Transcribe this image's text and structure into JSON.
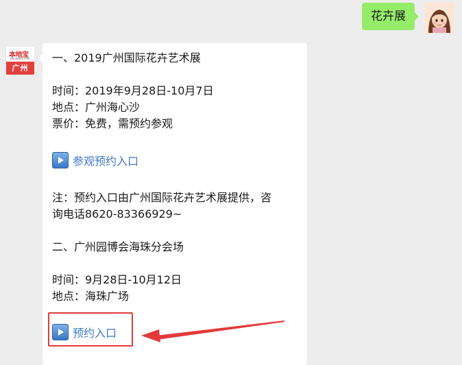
{
  "chat": {
    "outgoing_message": "花卉展",
    "incoming": {
      "avatar_logo_text": "本地宝",
      "avatar_logo_small": "Bendibao.com",
      "avatar_city": "广州",
      "heading1": "一、2019广州国际花卉艺术展",
      "time1": "时间：2019年9月28日-10月7日",
      "place1": "地点：广州海心沙",
      "ticket1": "票价：免费，需预约参观",
      "link1_label": "参观预约入口",
      "note_line1": "注：预约入口由广州国际花卉艺术展提供，咨",
      "note_line2": "询电话8620-83366929~",
      "heading2": "二、广州园博会海珠分会场",
      "time2": "时间：9月28日-10月12日",
      "place2": "地点：海珠广场",
      "link2_label": "预约入口"
    }
  },
  "colors": {
    "chat_background": "#ededed",
    "outgoing_bubble": "#95ec69",
    "link": "#3e79c9",
    "highlight": "#e23a3a"
  }
}
